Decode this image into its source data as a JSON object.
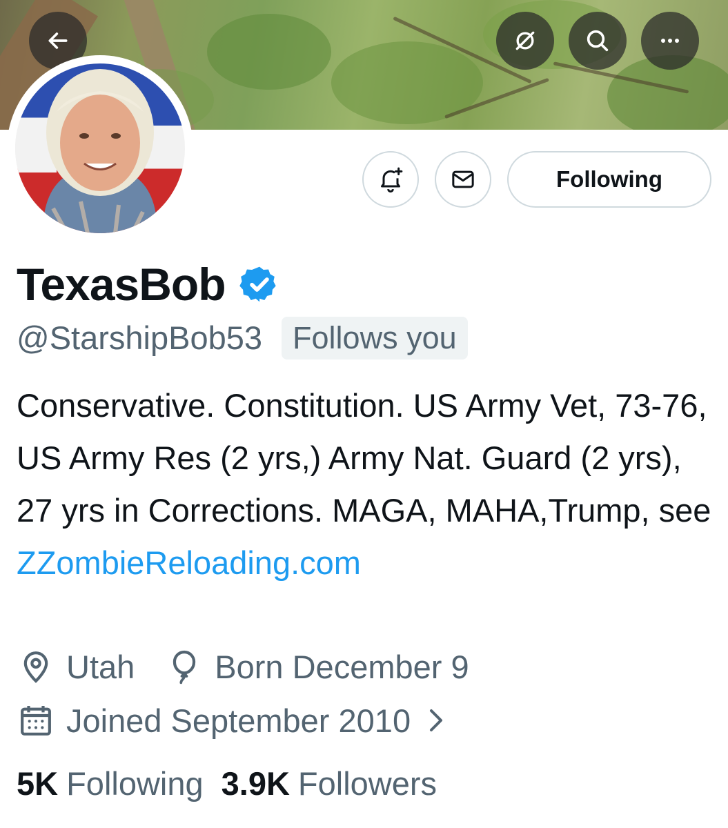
{
  "profile": {
    "display_name": "TexasBob",
    "handle": "@StarshipBob53",
    "follows_you_label": "Follows you",
    "bio_text": "Conservative. Constitution. US Army Vet, 73-76, US Army Res (2 yrs,) Army Nat. Guard (2 yrs), 27 yrs in Corrections. MAGA, MAHA,Trump, see ",
    "bio_link": "ZZombieReloading.com",
    "location": "Utah",
    "birthday": "Born December 9",
    "joined": "Joined September 2010",
    "verified": true
  },
  "actions": {
    "following_label": "Following"
  },
  "stats": {
    "following_count": "5K",
    "following_label": "Following",
    "followers_count": "3.9K",
    "followers_label": "Followers"
  },
  "colors": {
    "accent": "#1d9bf0",
    "text_primary": "#0f1419",
    "text_secondary": "#536471",
    "border": "#cfd9de",
    "badge_bg": "#eff3f4"
  },
  "icons": {
    "top_bar": [
      "back-arrow-icon",
      "grok-icon",
      "search-icon",
      "more-icon"
    ],
    "action_bar": [
      "notification-bell-plus-icon",
      "mail-icon"
    ],
    "meta": [
      "location-pin-icon",
      "balloon-icon",
      "calendar-icon",
      "chevron-right-icon"
    ]
  }
}
